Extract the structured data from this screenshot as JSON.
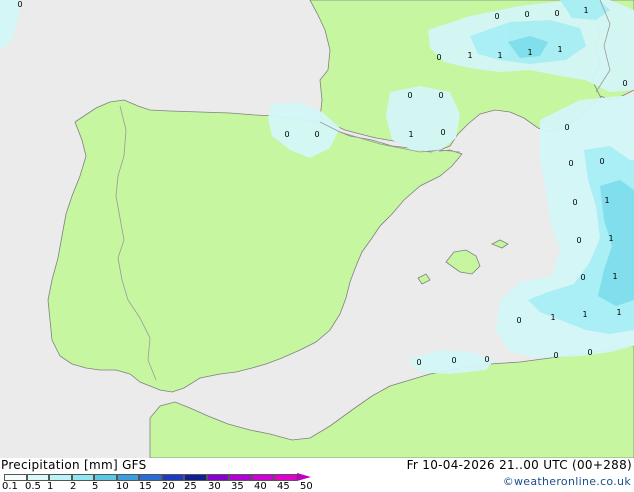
{
  "map": {
    "colors": {
      "sea": "#ebebeb",
      "land": "#c6f6a0",
      "border": "#9a9a9a",
      "coast": "#808080",
      "precip_light": "#d4f7f7",
      "precip_mid": "#a6eef4",
      "precip_strong": "#7ddcec"
    },
    "values": [
      {
        "id": "p1",
        "label": "0"
      },
      {
        "id": "p2",
        "label": "0"
      },
      {
        "id": "p3",
        "label": "0"
      },
      {
        "id": "p4",
        "label": "1"
      },
      {
        "id": "p5",
        "label": "0"
      },
      {
        "id": "p6",
        "label": "1"
      },
      {
        "id": "p7",
        "label": "1"
      },
      {
        "id": "p8",
        "label": "1"
      },
      {
        "id": "p9",
        "label": "1"
      },
      {
        "id": "p10",
        "label": "0"
      },
      {
        "id": "p11",
        "label": "0"
      },
      {
        "id": "p12",
        "label": "0"
      },
      {
        "id": "p13",
        "label": "1"
      },
      {
        "id": "p14",
        "label": "0"
      },
      {
        "id": "p15",
        "label": "0"
      },
      {
        "id": "p16",
        "label": "0"
      },
      {
        "id": "p17",
        "label": "0"
      },
      {
        "id": "p18",
        "label": "0"
      },
      {
        "id": "p19",
        "label": "0"
      },
      {
        "id": "p20",
        "label": "0"
      },
      {
        "id": "p21",
        "label": "1"
      },
      {
        "id": "p22",
        "label": "0"
      },
      {
        "id": "p23",
        "label": "1"
      },
      {
        "id": "p24",
        "label": "1"
      },
      {
        "id": "p25",
        "label": "0"
      },
      {
        "id": "p26",
        "label": "0"
      },
      {
        "id": "p27",
        "label": "1"
      },
      {
        "id": "p28",
        "label": "1"
      },
      {
        "id": "p29",
        "label": "1"
      },
      {
        "id": "p30",
        "label": "0"
      },
      {
        "id": "p31",
        "label": "0"
      },
      {
        "id": "p32",
        "label": "0"
      },
      {
        "id": "p33",
        "label": "0"
      },
      {
        "id": "p34",
        "label": "0"
      },
      {
        "id": "p35",
        "label": "0"
      }
    ]
  },
  "legend": {
    "title": "Precipitation [mm]  GFS",
    "ticks": [
      "0.1",
      "0.5",
      "1",
      "2",
      "5",
      "10",
      "15",
      "20",
      "25",
      "30",
      "35",
      "40",
      "45",
      "50"
    ],
    "colors": [
      "#f5fefe",
      "#dafafa",
      "#b8f4f8",
      "#90e6f2",
      "#5ac8e6",
      "#3a9ee0",
      "#2a6cd6",
      "#1a3cc0",
      "#102090",
      "#8a00d2",
      "#b200d8",
      "#d000d6",
      "#e400cc"
    ]
  },
  "valid_time": "Fr 10-04-2026 21..00 UTC (00+288)",
  "credit": "©weatheronline.co.uk"
}
